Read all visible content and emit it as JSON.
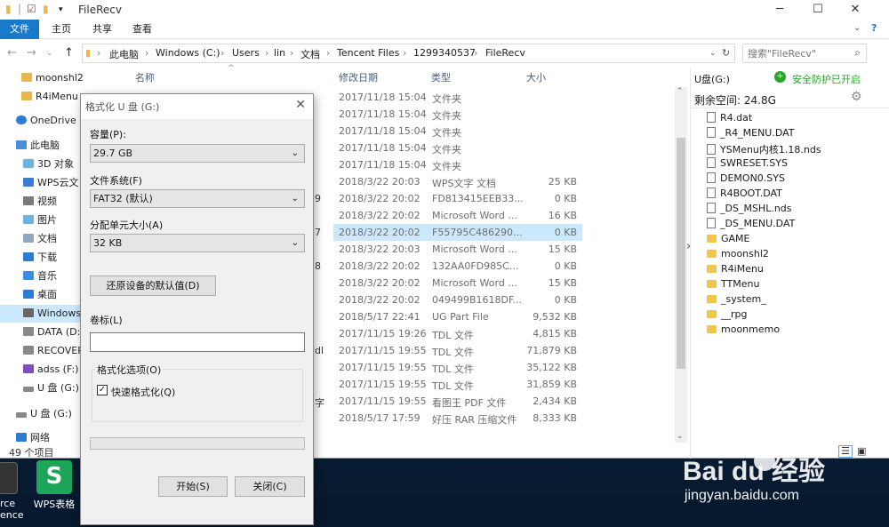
{
  "explorer": {
    "title": "FileRecv",
    "ribbon_tabs": [
      "文件",
      "主页",
      "共享",
      "查看"
    ],
    "breadcrumb": [
      "此电脑",
      "Windows (C:)",
      "Users",
      "lin",
      "文档",
      "Tencent Files",
      "1299340537",
      "FileRecv"
    ],
    "search_placeholder": "搜索\"FileRecv\"",
    "nav": [
      {
        "label": "moonshl2",
        "icon": "folder-icon"
      },
      {
        "label": "R4iMenu",
        "icon": "folder-icon"
      },
      {
        "label": "OneDrive",
        "icon": "cloud-icon"
      },
      {
        "label": "此电脑",
        "icon": "computer-icon"
      },
      {
        "label": "3D 对象",
        "icon": "folder-icon"
      },
      {
        "label": "WPS云文",
        "icon": "cloud-icon"
      },
      {
        "label": "视频",
        "icon": "video-icon"
      },
      {
        "label": "图片",
        "icon": "picture-icon"
      },
      {
        "label": "文档",
        "icon": "document-icon"
      },
      {
        "label": "下载",
        "icon": "download-icon"
      },
      {
        "label": "音乐",
        "icon": "music-icon"
      },
      {
        "label": "桌面",
        "icon": "desktop-icon"
      },
      {
        "label": "Windows",
        "icon": "drive-icon"
      },
      {
        "label": "DATA (D:",
        "icon": "drive-icon"
      },
      {
        "label": "RECOVER",
        "icon": "drive-icon"
      },
      {
        "label": "adss (F:)",
        "icon": "vs-icon"
      },
      {
        "label": "U 盘 (G:)",
        "icon": "usb-drive-icon"
      },
      {
        "label": "U 盘 (G:)",
        "icon": "usb-drive-icon"
      },
      {
        "label": "网络",
        "icon": "network-icon"
      }
    ],
    "columns": {
      "name": "名称",
      "modified": "修改日期",
      "type": "类型",
      "size": "大小"
    },
    "files": [
      {
        "peek": "",
        "date": "2017/11/18 15:04",
        "type": "文件夹",
        "size": ""
      },
      {
        "peek": "",
        "date": "2017/11/18 15:04",
        "type": "文件夹",
        "size": ""
      },
      {
        "peek": "",
        "date": "2017/11/18 15:04",
        "type": "文件夹",
        "size": ""
      },
      {
        "peek": "",
        "date": "2017/11/18 15:04",
        "type": "文件夹",
        "size": ""
      },
      {
        "peek": "",
        "date": "2017/11/18 15:04",
        "type": "文件夹",
        "size": ""
      },
      {
        "peek": "",
        "date": "2018/3/22 20:03",
        "type": "WPS文字 文档",
        "size": "25 KB"
      },
      {
        "peek": "9",
        "date": "2018/3/22 20:02",
        "type": "FD813415EEB33...",
        "size": "0 KB"
      },
      {
        "peek": "",
        "date": "2018/3/22 20:02",
        "type": "Microsoft Word ...",
        "size": "16 KB"
      },
      {
        "peek": "7",
        "date": "2018/3/22 20:02",
        "type": "F55795C486290...",
        "size": "0 KB"
      },
      {
        "peek": "",
        "date": "2018/3/22 20:03",
        "type": "Microsoft Word ...",
        "size": "15 KB"
      },
      {
        "peek": "8",
        "date": "2018/3/22 20:02",
        "type": "132AA0FD985C...",
        "size": "0 KB"
      },
      {
        "peek": "",
        "date": "2018/3/22 20:02",
        "type": "Microsoft Word ...",
        "size": "15 KB"
      },
      {
        "peek": "",
        "date": "2018/3/22 20:02",
        "type": "049499B1618DF...",
        "size": "0 KB"
      },
      {
        "peek": "",
        "date": "2018/5/17 22:41",
        "type": "UG Part File",
        "size": "9,532 KB"
      },
      {
        "peek": "",
        "date": "2017/11/15 19:26",
        "type": "TDL 文件",
        "size": "4,815 KB"
      },
      {
        "peek": "dl",
        "date": "2017/11/15 19:55",
        "type": "TDL 文件",
        "size": "71,879 KB"
      },
      {
        "peek": "",
        "date": "2017/11/15 19:55",
        "type": "TDL 文件",
        "size": "35,122 KB"
      },
      {
        "peek": "",
        "date": "2017/11/15 19:55",
        "type": "TDL 文件",
        "size": "31,859 KB"
      },
      {
        "peek": "字",
        "date": "2017/11/15 19:55",
        "type": "看图王 PDF 文件",
        "size": "2,434 KB"
      },
      {
        "peek": "",
        "date": "2018/5/17 17:59",
        "type": "好压 RAR 压缩文件",
        "size": "8,333 KB"
      }
    ],
    "selected_file_index": 8,
    "status": "49 个项目"
  },
  "drive_panel": {
    "title": "U盘(G:)",
    "protect": "安全防护已开启",
    "free_space": "剩余空间: 24.8G",
    "items": [
      {
        "name": "R4.dat",
        "kind": "file"
      },
      {
        "name": "_R4_MENU.DAT",
        "kind": "file"
      },
      {
        "name": "YSMenu内核1.18.nds",
        "kind": "file"
      },
      {
        "name": "SWRESET.SYS",
        "kind": "file"
      },
      {
        "name": "DEMON0.SYS",
        "kind": "file"
      },
      {
        "name": "R4BOOT.DAT",
        "kind": "file"
      },
      {
        "name": "_DS_MSHL.nds",
        "kind": "file"
      },
      {
        "name": "_DS_MENU.DAT",
        "kind": "file"
      },
      {
        "name": "GAME",
        "kind": "folder"
      },
      {
        "name": "moonshl2",
        "kind": "folder"
      },
      {
        "name": "R4iMenu",
        "kind": "folder"
      },
      {
        "name": "TTMenu",
        "kind": "folder"
      },
      {
        "name": "_system_",
        "kind": "folder"
      },
      {
        "name": "__rpg",
        "kind": "folder"
      },
      {
        "name": "moonmemo",
        "kind": "folder"
      }
    ]
  },
  "format_dialog": {
    "title": "格式化 U 盘 (G:)",
    "capacity_label": "容量(P):",
    "capacity_value": "29.7 GB",
    "filesystem_label": "文件系统(F)",
    "filesystem_value": "FAT32 (默认)",
    "unit_label": "分配单元大小(A)",
    "unit_value": "32 KB",
    "restore_button": "还原设备的默认值(D)",
    "volume_label": "卷标(L)",
    "volume_value": "",
    "options_label": "格式化选项(O)",
    "quick_format_label": "快速格式化(Q)",
    "quick_format_checked": true,
    "progress": 0,
    "start_button": "开始(S)",
    "close_button": "关闭(C)"
  },
  "desktop": {
    "icons": [
      {
        "label": "WPS表格"
      }
    ],
    "partial_labels": [
      "rce",
      "ence"
    ]
  },
  "watermark": {
    "logo": "Bai du 经验",
    "url": "jingyan.baidu.com"
  },
  "colors": {
    "accent": "#1979ca",
    "selection": "#cce8ff",
    "protect_green": "#2aa52a"
  }
}
